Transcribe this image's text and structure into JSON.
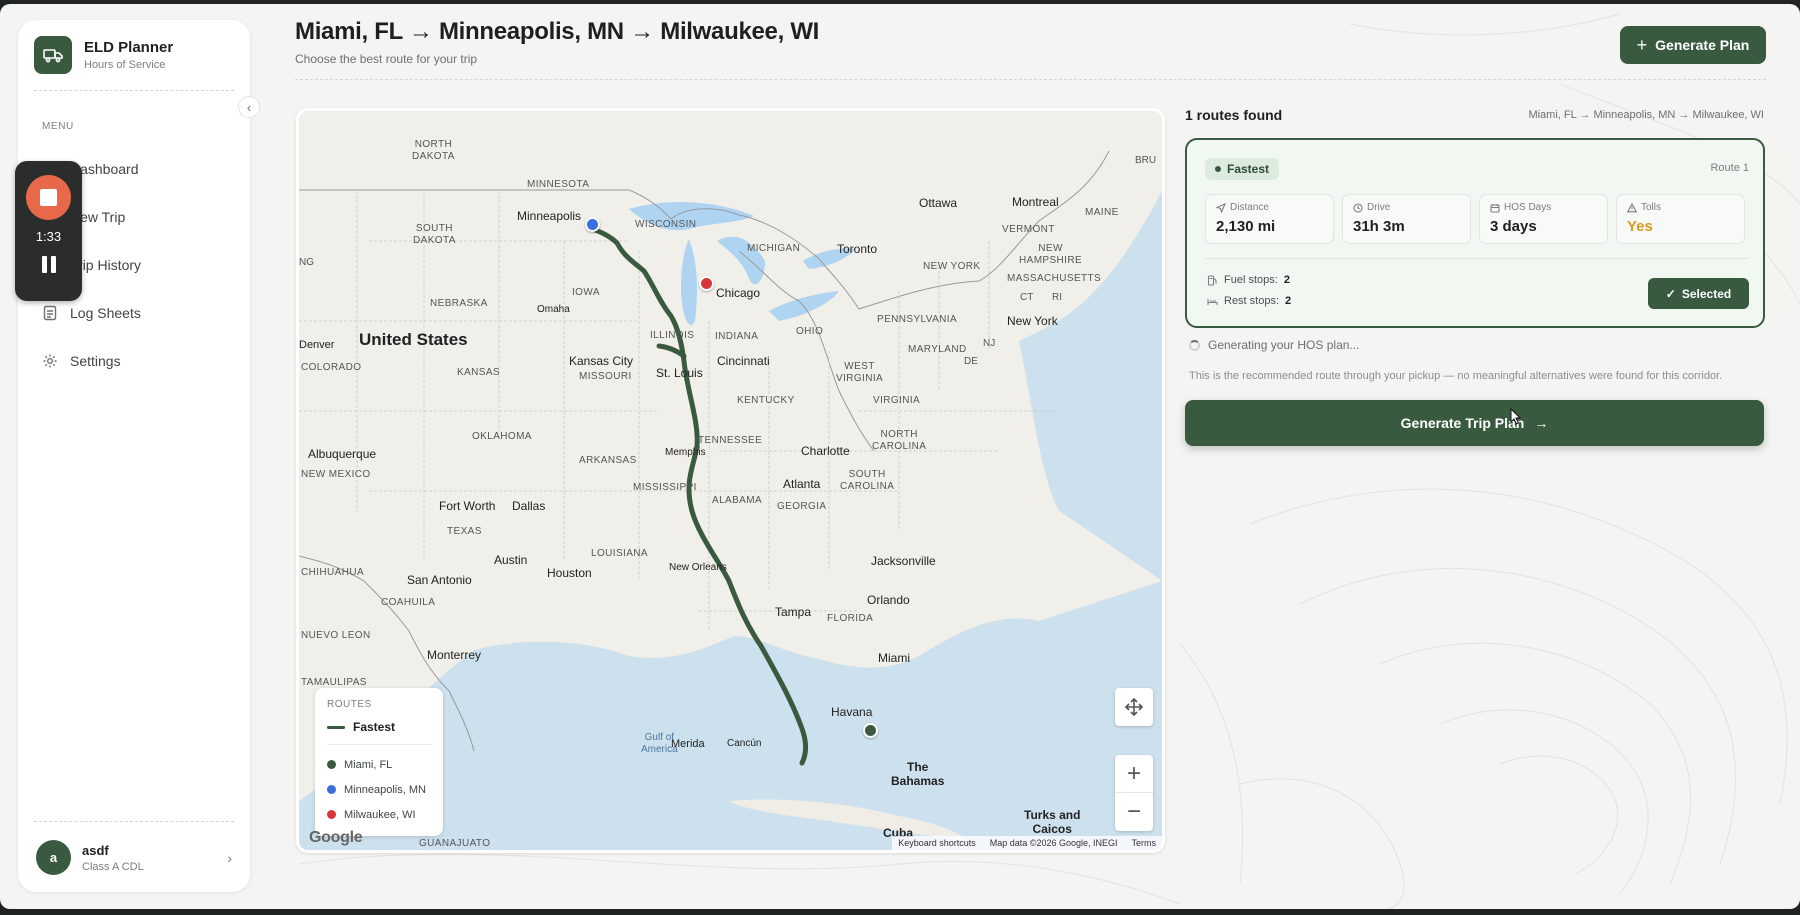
{
  "app": {
    "name": "ELD Planner",
    "subtitle": "Hours of Service"
  },
  "sidebar": {
    "menu_label": "MENU",
    "items": [
      {
        "label": "Dashboard",
        "icon": "grid-icon"
      },
      {
        "label": "New Trip",
        "icon": "plus-icon"
      },
      {
        "label": "Trip History",
        "icon": "history-icon"
      },
      {
        "label": "Log Sheets",
        "icon": "document-icon"
      },
      {
        "label": "Settings",
        "icon": "gear-icon"
      }
    ],
    "user": {
      "initial": "a",
      "name": "asdf",
      "role": "Class A CDL"
    }
  },
  "recorder": {
    "time": "1:33"
  },
  "header": {
    "title": "Miami, FL → Minneapolis, MN → Milwaukee, WI",
    "subtitle": "Choose the best route for your trip",
    "generate_label": "Generate Plan"
  },
  "map": {
    "labels": {
      "north_dakota": "NORTH\nDAKOTA",
      "minnesota": "MINNESOTA",
      "south_dakota": "SOUTH\nDAKOTA",
      "wisconsin": "WISCONSIN",
      "michigan": "MICHIGAN",
      "iowa": "IOWA",
      "nebraska": "NEBRASKA",
      "illinois": "ILLINOIS",
      "indiana": "INDIANA",
      "ohio": "OHIO",
      "pennsylvania": "PENNSYLVANIA",
      "new_york": "NEW YORK",
      "vermont": "VERMONT",
      "new_hampshire": "NEW\nHAMPSHIRE",
      "maine": "MAINE",
      "massachusetts": "MASSACHUSETTS",
      "ct": "CT",
      "ri": "RI",
      "nj": "NJ",
      "maryland": "MARYLAND",
      "de": "DE",
      "west_virginia": "WEST\nVIRGINIA",
      "virginia": "VIRGINIA",
      "kentucky": "KENTUCKY",
      "tennessee": "TENNESSEE",
      "north_carolina": "NORTH\nCAROLINA",
      "south_carolina": "SOUTH\nCAROLINA",
      "georgia": "GEORGIA",
      "alabama": "ALABAMA",
      "mississippi": "MISSISSIPPI",
      "louisiana": "LOUISIANA",
      "arkansas": "ARKANSAS",
      "missouri": "MISSOURI",
      "kansas": "KANSAS",
      "oklahoma": "OKLAHOMA",
      "texas": "TEXAS",
      "colorado": "COLORADO",
      "new_mexico": "NEW MEXICO",
      "florida": "FLORIDA",
      "coahuila": "COAHUILA",
      "nuevo_leon": "NUEVO LEON",
      "tamaulipas": "TAMAULIPAS",
      "chihuahua": "CHIHUAHUA",
      "guanajuato": "GUANAJUATO",
      "bru": "BRU",
      "ng": "NG",
      "united_states": "United States",
      "gulf": "Gulf of\nAmerica",
      "bahamas": "The\nBahamas",
      "cuba": "Cuba",
      "turks": "Turks and\nCaicos",
      "minneapolis": "Minneapolis",
      "ottawa": "Ottawa",
      "montreal": "Montreal",
      "toronto": "Toronto",
      "chicago": "Chicago",
      "omaha": "Omaha",
      "new_york_city": "New York",
      "denver": "Denver",
      "kansas_city": "Kansas City",
      "st_louis": "St. Louis",
      "cincinnati": "Cincinnati",
      "albuquerque": "Albuquerque",
      "memphis": "Memphis",
      "charlotte": "Charlotte",
      "atlanta": "Atlanta",
      "fort_worth": "Fort Worth",
      "dallas": "Dallas",
      "austin": "Austin",
      "houston": "Houston",
      "san_antonio": "San Antonio",
      "new_orleans": "New Orleans",
      "jacksonville": "Jacksonville",
      "orlando": "Orlando",
      "tampa": "Tampa",
      "miami": "Miami",
      "havana": "Havana",
      "monterrey": "Monterrey",
      "merida": "Merida",
      "cancun": "Cancún"
    },
    "legend": {
      "title": "ROUTES",
      "route": "Fastest",
      "stops": [
        {
          "label": "Miami, FL",
          "color": "#3a5a40"
        },
        {
          "label": "Minneapolis, MN",
          "color": "#3b6fe0"
        },
        {
          "label": "Milwaukee, WI",
          "color": "#d8353a"
        }
      ]
    },
    "attribution": {
      "shortcuts": "Keyboard shortcuts",
      "data": "Map data ©2026 Google, INEGI",
      "terms": "Terms",
      "google": "Google"
    }
  },
  "results": {
    "count": "1 routes found",
    "path": "Miami, FL → Minneapolis, MN → Milwaukee, WI",
    "route": {
      "badge": "Fastest",
      "number": "Route 1",
      "stats": [
        {
          "label": "Distance",
          "value": "2,130 mi",
          "icon": "navigation-icon"
        },
        {
          "label": "Drive",
          "value": "31h 3m",
          "icon": "clock-icon"
        },
        {
          "label": "HOS Days",
          "value": "3 days",
          "icon": "calendar-icon"
        },
        {
          "label": "Tolls",
          "value": "Yes",
          "icon": "warning-icon"
        }
      ],
      "fuel_label": "Fuel stops:",
      "fuel_value": "2",
      "rest_label": "Rest stops:",
      "rest_value": "2",
      "selected_label": "Selected"
    },
    "generating": "Generating your HOS plan...",
    "note": "This is the recommended route through your pickup — no meaningful alternatives were found for this corridor.",
    "trip_button": "Generate Trip Plan"
  },
  "colors": {
    "brand": "#3a5a40",
    "accent_warn": "#d99a1e",
    "origin": "#3a5a40",
    "waypoint": "#3b6fe0",
    "destination": "#d8353a"
  }
}
